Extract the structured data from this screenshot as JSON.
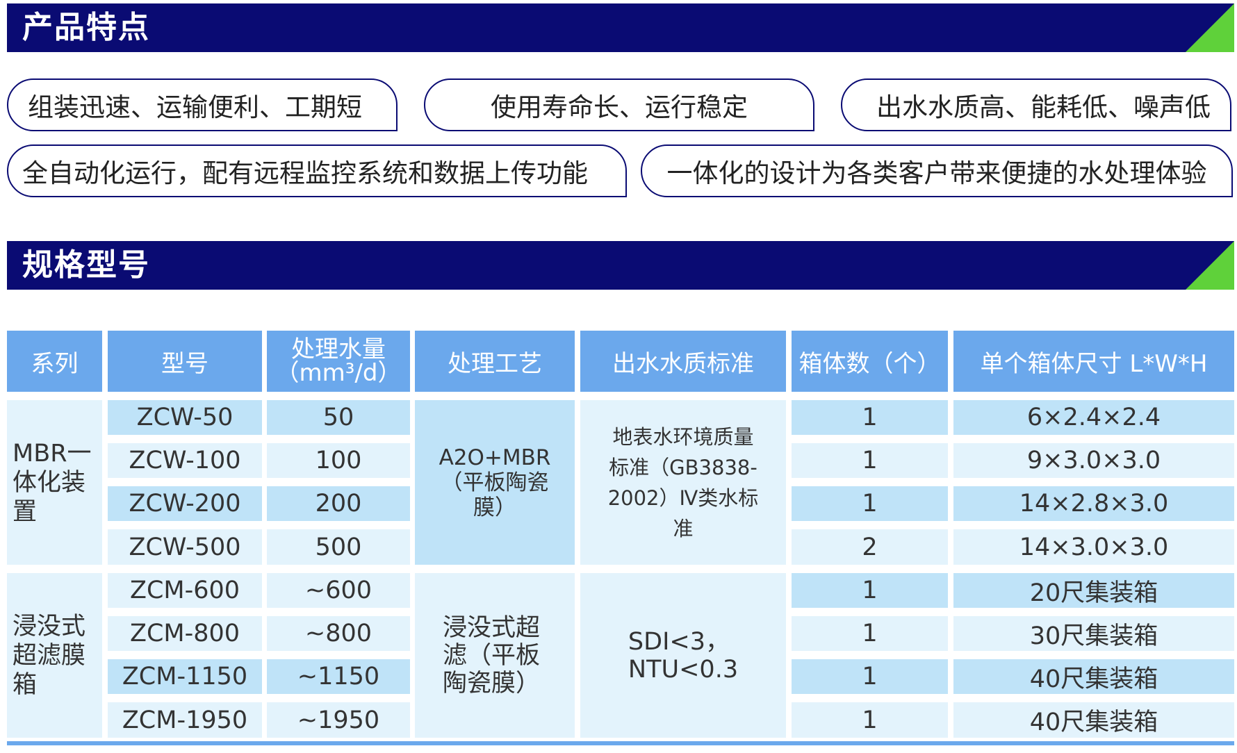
{
  "features_section": {
    "title": "产品特点",
    "items": [
      "组装迅速、运输便利、工期短",
      "使用寿命长、运行稳定",
      "出水水质高、能耗低、噪声低",
      "全自动化运行，配有远程监控系统和数据上传功能",
      "一体化的设计为各类客户带来便捷的水处理体验"
    ]
  },
  "specs_section": {
    "title": "规格型号",
    "headers": {
      "series": "系列",
      "model": "型号",
      "capacity_line1": "处理水量",
      "capacity_line2": "（mm³/d）",
      "process": "处理工艺",
      "standard": "出水水质标准",
      "boxes": "箱体数（个）",
      "size": "单个箱体尺寸 L*W*H"
    },
    "groups": [
      {
        "series": "MBR一体化装置",
        "process": "A2O+MBR（平板陶瓷膜）",
        "standard": "地表水环境质量标准（GB3838-2002）Ⅳ类水标准",
        "rows": [
          {
            "model": "ZCW-50",
            "capacity": "50",
            "boxes": "1",
            "size": "6×2.4×2.4"
          },
          {
            "model": "ZCW-100",
            "capacity": "100",
            "boxes": "1",
            "size": "9×3.0×3.0"
          },
          {
            "model": "ZCW-200",
            "capacity": "200",
            "boxes": "1",
            "size": "14×2.8×3.0"
          },
          {
            "model": "ZCW-500",
            "capacity": "500",
            "boxes": "2",
            "size": "14×3.0×3.0"
          }
        ]
      },
      {
        "series": "浸没式超滤膜箱",
        "process": "浸没式超滤（平板陶瓷膜）",
        "standard": "SDI<3，NTU<0.3",
        "rows": [
          {
            "model": "ZCM-600",
            "capacity": "~600",
            "boxes": "1",
            "size": "20尺集装箱"
          },
          {
            "model": "ZCM-800",
            "capacity": "~800",
            "boxes": "1",
            "size": "30尺集装箱"
          },
          {
            "model": "ZCM-1150",
            "capacity": "~1150",
            "boxes": "1",
            "size": "40尺集装箱"
          },
          {
            "model": "ZCM-1950",
            "capacity": "~1950",
            "boxes": "1",
            "size": "40尺集装箱"
          }
        ]
      }
    ]
  },
  "colors": {
    "header_bar": "#0a0b73",
    "accent_green": "#5fd13a",
    "table_header": "#6ba8ec",
    "cell_dark": "#bfe3f8",
    "cell_light": "#e3f3fc"
  }
}
